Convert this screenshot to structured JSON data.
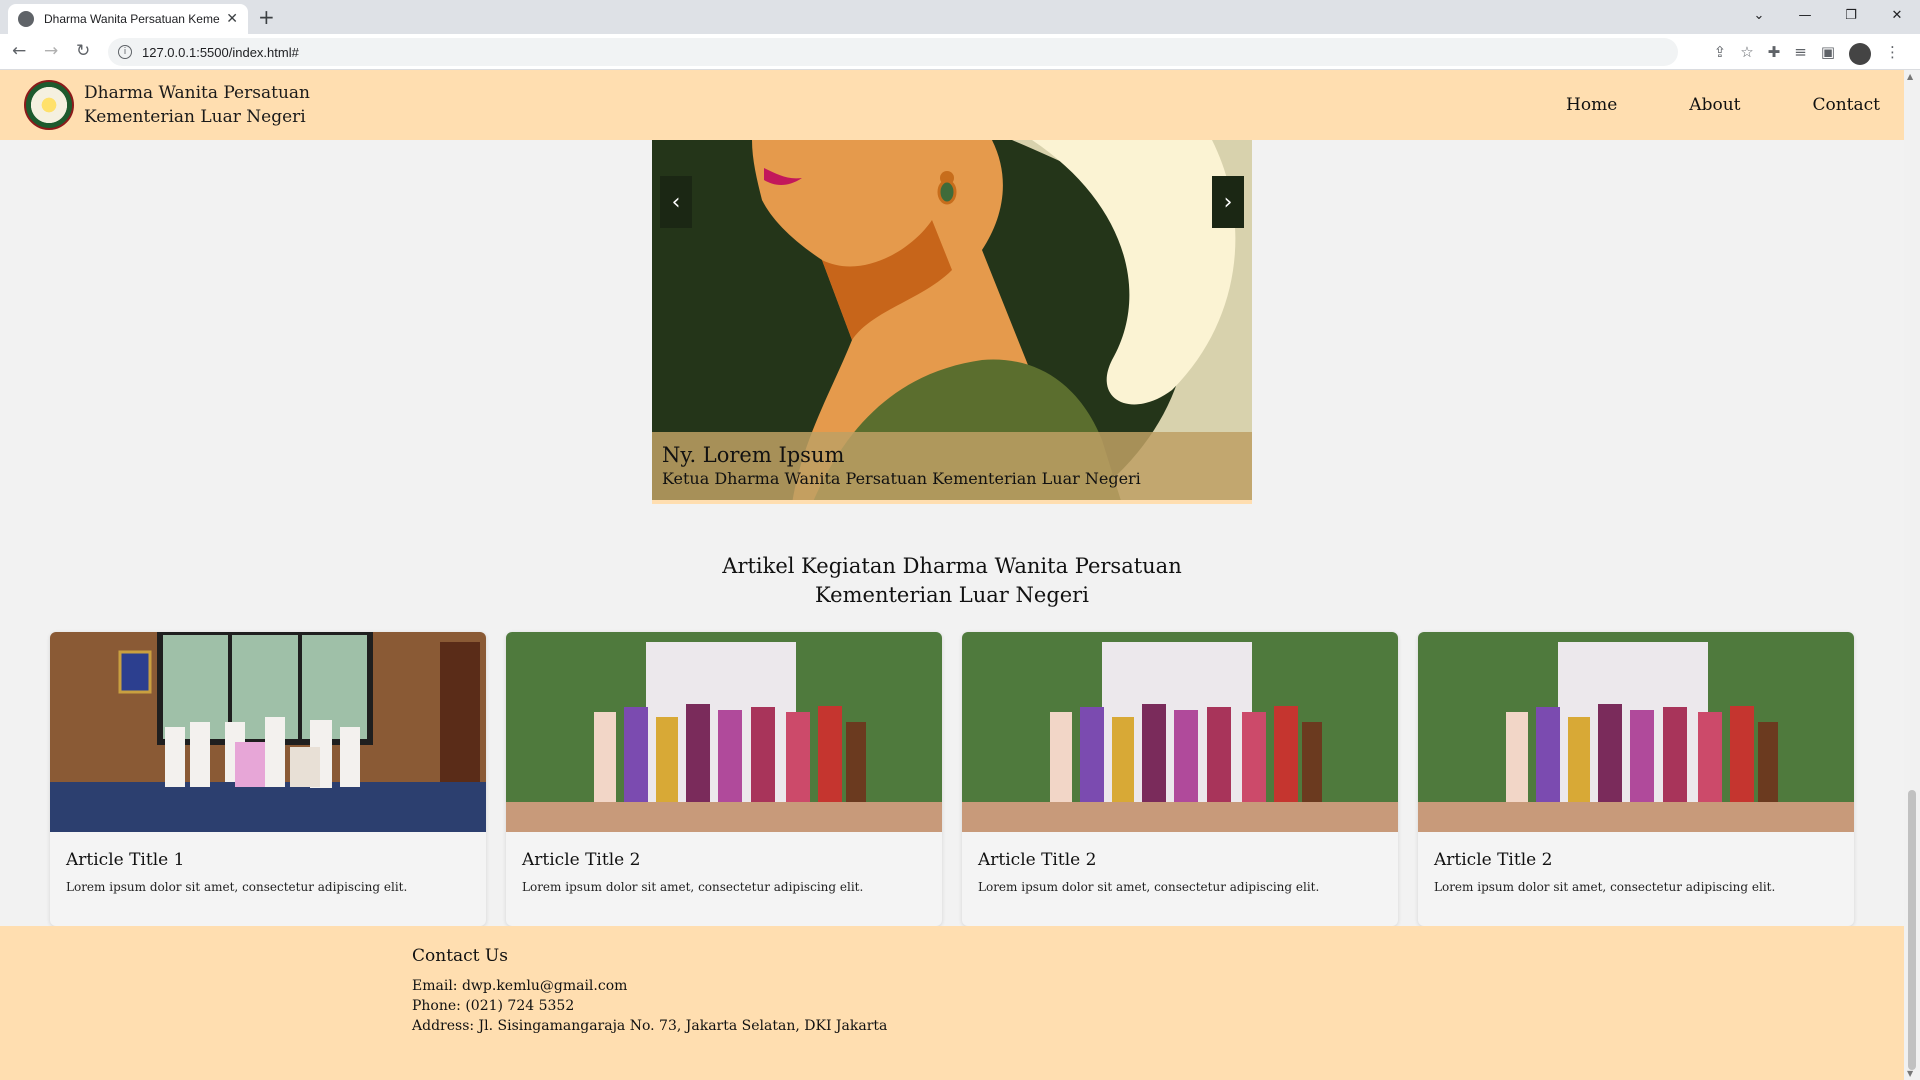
{
  "browser": {
    "tab_title": "Dharma Wanita Persatuan Kemen",
    "url": "127.0.0.1:5500/index.html#"
  },
  "site": {
    "brand_line1": "Dharma Wanita Persatuan",
    "brand_line2": "Kementerian Luar Negeri",
    "nav": [
      "Home",
      "About",
      "Contact"
    ]
  },
  "hero": {
    "name": "Ny. Lorem Ipsum",
    "role": "Ketua Dharma Wanita Persatuan Kementerian Luar Negeri",
    "prev_label": "‹",
    "next_label": "›"
  },
  "articles": {
    "heading_line1": "Artikel Kegiatan Dharma Wanita Persatuan",
    "heading_line2": "Kementerian Luar Negeri",
    "items": [
      {
        "title": "Article Title 1",
        "text": "Lorem ipsum dolor sit amet, consectetur adipiscing elit."
      },
      {
        "title": "Article Title 2",
        "text": "Lorem ipsum dolor sit amet, consectetur adipiscing elit."
      },
      {
        "title": "Article Title 2",
        "text": "Lorem ipsum dolor sit amet, consectetur adipiscing elit."
      },
      {
        "title": "Article Title 2",
        "text": "Lorem ipsum dolor sit amet, consectetur adipiscing elit."
      }
    ]
  },
  "footer": {
    "title": "Contact Us",
    "email": "Email: dwp.kemlu@gmail.com",
    "phone": "Phone: (021) 724 5352",
    "address": "Address: Jl. Sisingamangaraja No. 73, Jakarta Selatan, DKI Jakarta"
  },
  "colors": {
    "header_bg": "#ffdeb0",
    "page_bg": "#f2f2f2",
    "hero_bg": "#243519"
  }
}
